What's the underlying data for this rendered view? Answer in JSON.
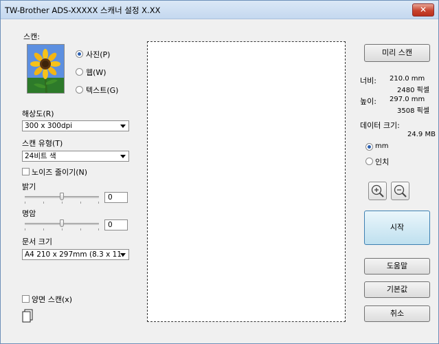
{
  "window": {
    "title": "TW-Brother ADS-XXXXX 스캐너 설정 X.XX",
    "close_icon": "✕"
  },
  "scan": {
    "label": "스캔:",
    "options": [
      "사진(P)",
      "웹(W)",
      "텍스트(G)"
    ],
    "selected": "사진(P)"
  },
  "resolution": {
    "label": "해상도(R)",
    "value": "300 x 300dpi"
  },
  "scan_type": {
    "label": "스캔 유형(T)",
    "value": "24비트 색"
  },
  "noise_reduction": {
    "label": "노이즈 줄이기(N)",
    "checked": false
  },
  "brightness": {
    "label": "밝기",
    "value": "0"
  },
  "contrast": {
    "label": "명암",
    "value": "0"
  },
  "document_size": {
    "label": "문서 크기",
    "value": "A4 210 x 297mm (8.3 x 11."
  },
  "duplex": {
    "label": "양면 스캔(x)",
    "checked": false
  },
  "right_panel": {
    "preview_button": "미리 스캔",
    "width_label": "너비:",
    "width_mm": "210.0 mm",
    "width_px": "2480 픽셀",
    "height_label": "높이:",
    "height_mm": "297.0 mm",
    "height_px": "3508 픽셀",
    "data_size_label": "데이터 크기:",
    "data_size_value": "24.9 MB",
    "unit_options": [
      "mm",
      "인치"
    ],
    "unit_selected": "mm",
    "start_button": "시작",
    "help_button": "도움말",
    "default_button": "기본값",
    "cancel_button": "취소"
  }
}
